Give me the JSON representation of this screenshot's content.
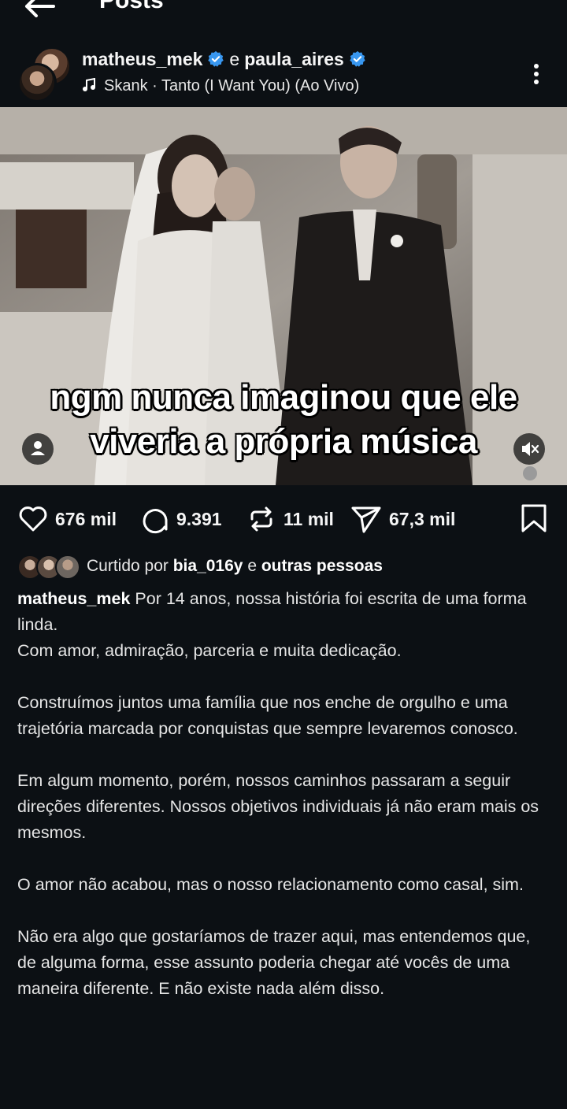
{
  "topbar": {
    "title": "Posts"
  },
  "post": {
    "author": "matheus_mek",
    "connector": "e",
    "collaborator": "paula_aires",
    "audio": "Skank · Tanto (I Want You) (Ao Vivo)"
  },
  "media": {
    "overlay_line1": "ngm nunca imaginou que ele",
    "overlay_line2": "viveria a própria música"
  },
  "actions": {
    "likes": "676 mil",
    "comments": "9.391",
    "reposts": "11 mil",
    "shares": "67,3 mil"
  },
  "liked_by": {
    "prefix": "Curtido por",
    "user": "bia_016y",
    "connector": "e",
    "others": "outras pessoas"
  },
  "caption": {
    "user": "matheus_mek",
    "paragraphs": [
      "Por 14 anos, nossa história foi escrita de uma forma linda.\nCom amor, admiração, parceria e muita dedicação.",
      "Construímos juntos uma família que nos enche de orgulho e uma trajetória marcada por conquistas que sempre levaremos conosco.",
      "Em algum momento, porém, nossos caminhos passaram a seguir direções diferentes. Nossos objetivos individuais já não eram mais os mesmos.",
      "O amor não acabou, mas o nosso relacionamento como casal, sim.",
      "Não era algo que gostaríamos de trazer aqui, mas entendemos que, de alguma forma, esse assunto poderia chegar até vocês de uma maneira diferente. E não existe nada além disso."
    ]
  },
  "colors": {
    "background": "#0c1014",
    "verified": "#3897f0",
    "text": "#f5f5f5"
  }
}
